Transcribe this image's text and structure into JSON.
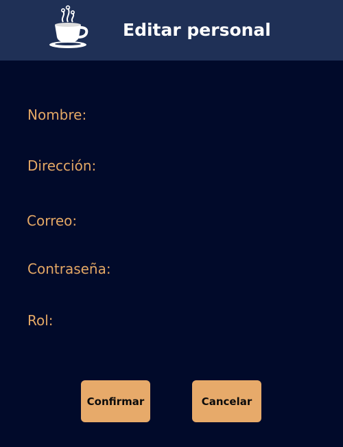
{
  "header": {
    "title": "Editar personal",
    "logo_icon": "coffee-cup-icon",
    "background_color": "#1f3056"
  },
  "form": {
    "fields": [
      {
        "label": "Nombre:"
      },
      {
        "label": "Dirección:"
      },
      {
        "label": "Correo:"
      },
      {
        "label": "Contraseña:"
      },
      {
        "label": "Rol:"
      }
    ],
    "label_color": "#e4a865"
  },
  "actions": {
    "confirm_label": "Confirmar",
    "cancel_label": "Cancelar",
    "button_color": "#e7aa6a"
  },
  "page": {
    "background_color": "#010a2a"
  }
}
